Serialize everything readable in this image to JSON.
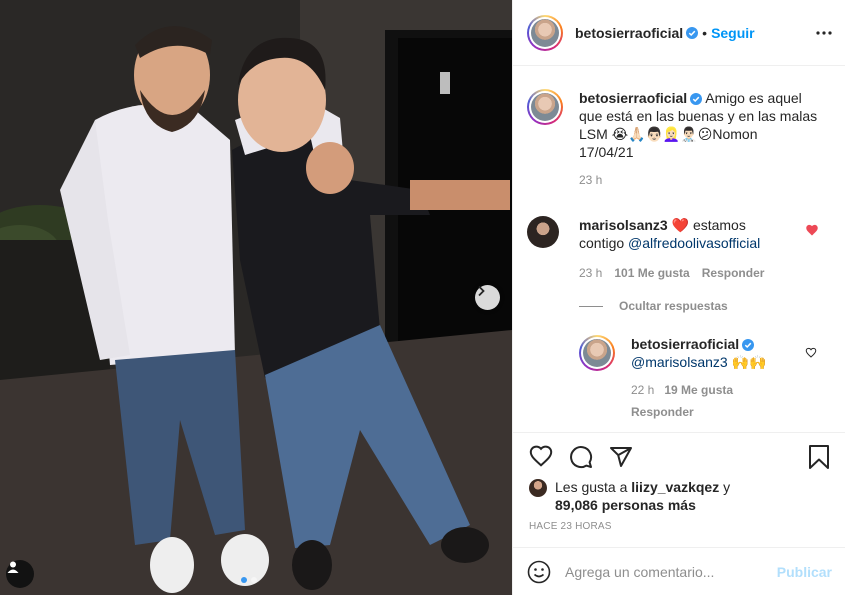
{
  "post": {
    "username": "betosierraoficial",
    "follow_label": "Seguir",
    "separator": "•"
  },
  "caption": {
    "username": "betosierraoficial",
    "text_line1": "Amigo es aquel",
    "text_line2": "que está en las buenas y en las malas",
    "text_line3_prefix": "LSM",
    "emojis": "😭🙏🏻👨🏻👱🏻‍♀️👨🏻‍⚕️😕",
    "text_line3_suffix": "Nomon",
    "text_line4": "17/04/21",
    "time": "23 h"
  },
  "comment": {
    "username": "marisolsanz3",
    "heart_emoji": "❤️",
    "text": "estamos",
    "text2_prefix": "contigo ",
    "mention": "@alfredoolivasofficial",
    "time": "23 h",
    "likes": "101 Me gusta",
    "reply_label": "Responder",
    "hide_replies": "Ocultar respuestas"
  },
  "reply": {
    "username": "betosierraoficial",
    "mention": "@marisolsanz3",
    "emojis": "🙌🙌",
    "time": "22 h",
    "likes": "19 Me gusta",
    "reply_label": "Responder"
  },
  "likes_summary": {
    "prefix": "Les gusta a ",
    "user": "liizy_vazkqez",
    "middle": " y",
    "count": "89,086 personas más"
  },
  "timestamp": "HACE 23 HORAS",
  "composer": {
    "placeholder": "Agrega un comentario...",
    "publish_label": "Publicar"
  },
  "carousel": {
    "total": 2,
    "active_index": 0
  },
  "colors": {
    "accent": "#0095f6",
    "like_red": "#ed4956",
    "verified": "#3897f0",
    "muted": "#8e8e8e"
  },
  "icons": [
    "more-options-icon",
    "verified-badge-icon",
    "heart-icon",
    "comment-icon",
    "share-icon",
    "bookmark-icon",
    "next-arrow-icon",
    "user-tag-icon",
    "emoji-icon"
  ]
}
